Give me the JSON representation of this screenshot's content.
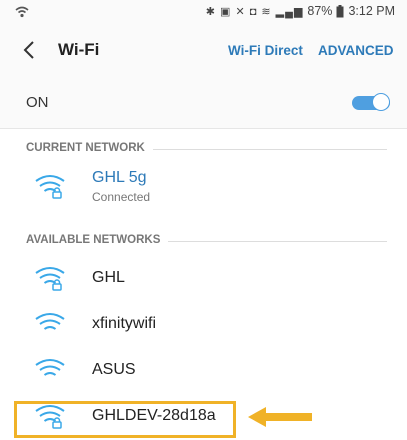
{
  "status_bar": {
    "icons": [
      "bluetooth-icon",
      "nfc-icon",
      "mute-icon",
      "data-icon",
      "wifi-icon",
      "signal-icon"
    ],
    "battery": "87%",
    "time": "3:12 PM"
  },
  "header": {
    "back_icon": "chevron-left-icon",
    "title": "Wi-Fi",
    "wifi_direct_label": "Wi-Fi Direct",
    "advanced_label": "ADVANCED"
  },
  "toggle_row": {
    "label": "ON",
    "state": true
  },
  "current_network": {
    "section_title": "CURRENT NETWORK",
    "name": "GHL 5g",
    "status": "Connected",
    "locked": true
  },
  "available_networks": {
    "section_title": "AVAILABLE NETWORKS",
    "items": [
      {
        "name": "GHL",
        "locked": true
      },
      {
        "name": "xfinitywifi",
        "locked": false
      },
      {
        "name": "ASUS",
        "locked": false
      },
      {
        "name": "GHLDEV-28d18a",
        "locked": true
      }
    ]
  },
  "colors": {
    "accent": "#2d7ab8",
    "toggle": "#4f9fe0",
    "highlight": "#f0b227",
    "wifi_icon": "#3aa8e8"
  }
}
